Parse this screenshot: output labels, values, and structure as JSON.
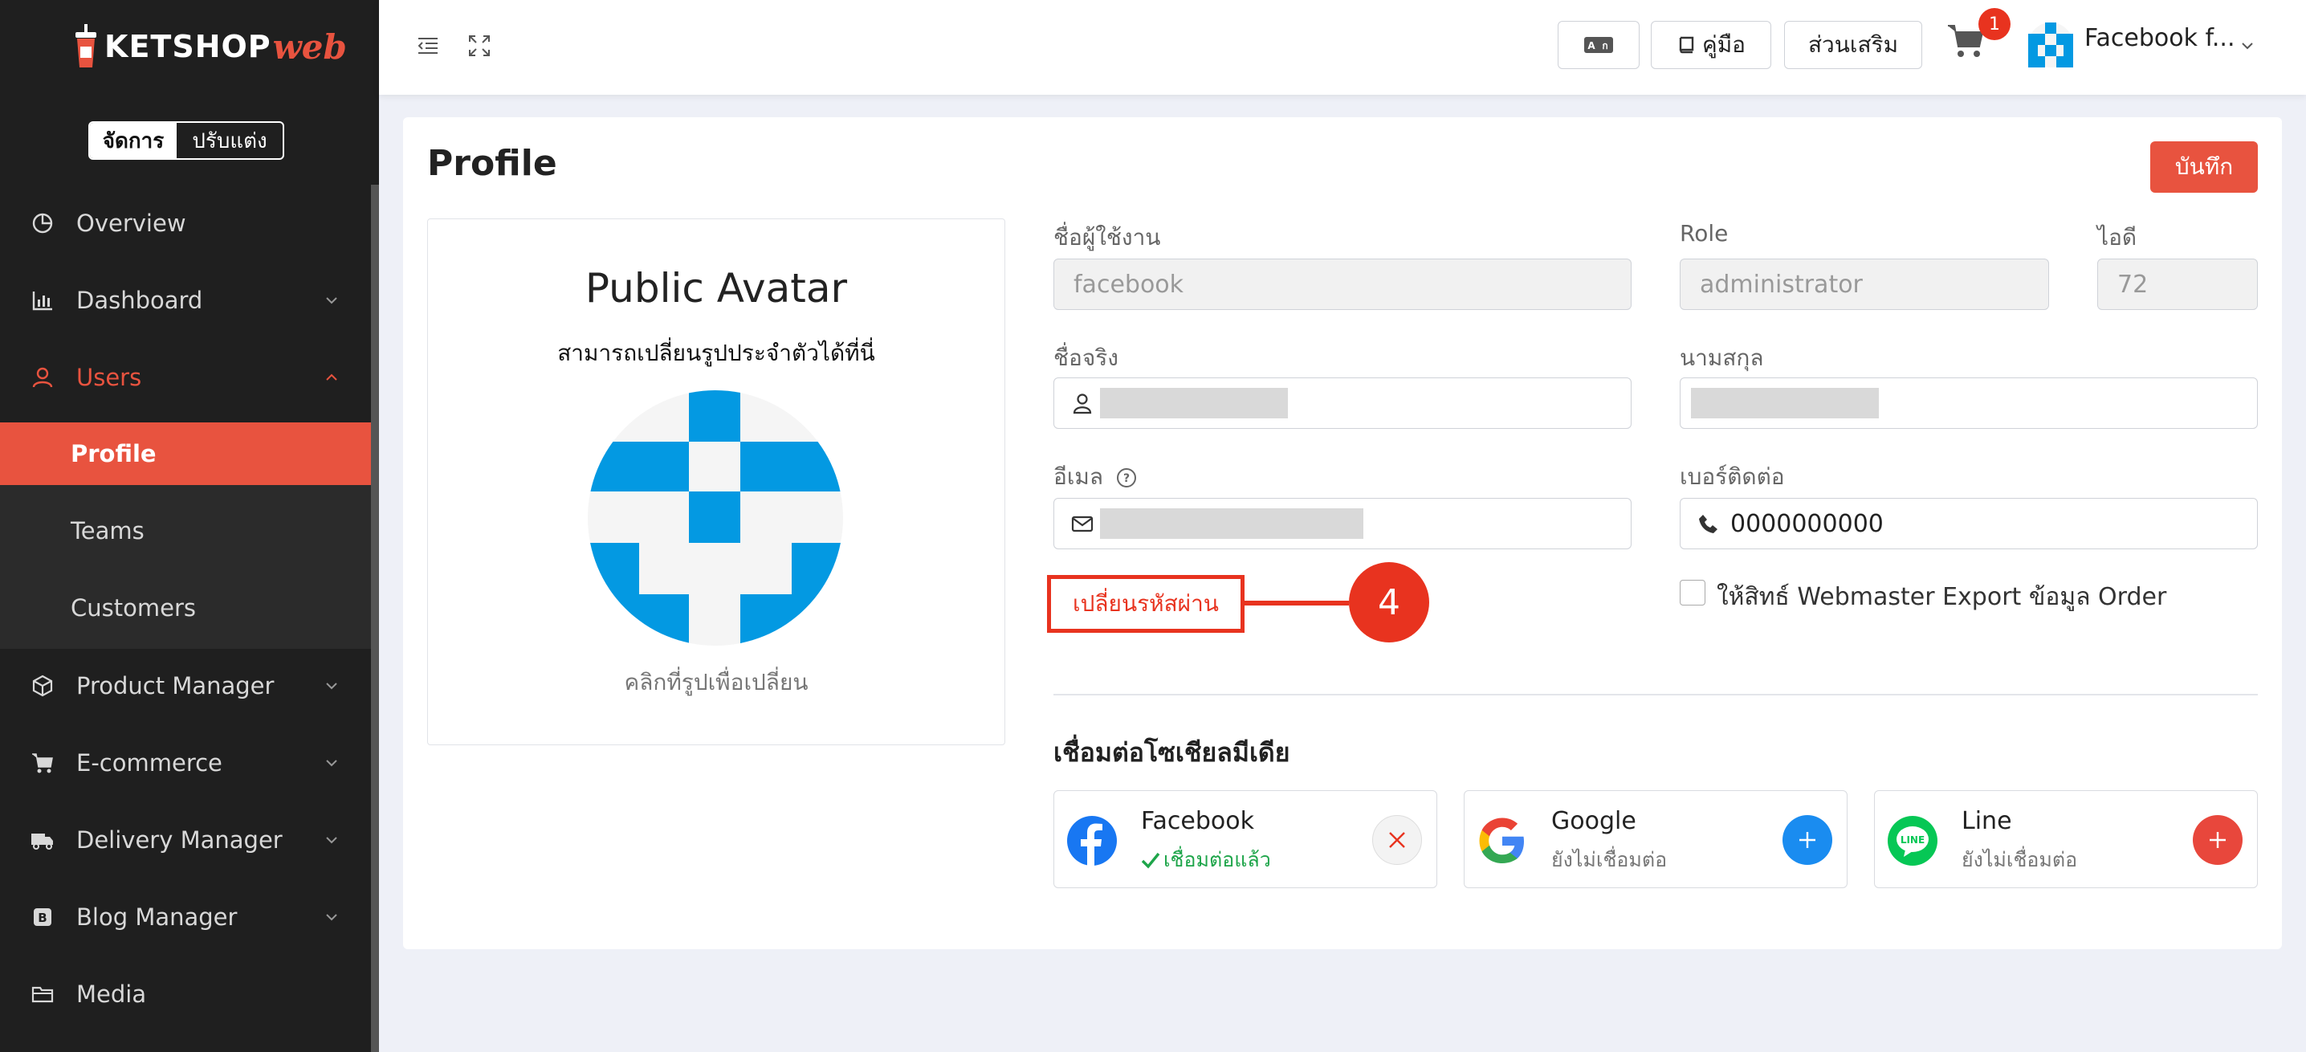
{
  "brand": {
    "name_a": "KETSHOP",
    "name_b": "web"
  },
  "mode_toggle": {
    "manage": "จัดการ",
    "customize": "ปรับแต่ง"
  },
  "sidebar": {
    "items": [
      {
        "label": "Overview"
      },
      {
        "label": "Dashboard"
      },
      {
        "label": "Users"
      },
      {
        "label": "Product Manager"
      },
      {
        "label": "E-commerce"
      },
      {
        "label": "Delivery Manager"
      },
      {
        "label": "Blog Manager"
      },
      {
        "label": "Media"
      }
    ],
    "users_sub": [
      {
        "label": "Profile"
      },
      {
        "label": "Teams"
      },
      {
        "label": "Customers"
      }
    ]
  },
  "topbar": {
    "manual_label": "คู่มือ",
    "addons_label": "ส่วนเสริม",
    "cart_count": "1",
    "user_name": "Facebook f..."
  },
  "page": {
    "title": "Profile",
    "save_label": "บันทึก"
  },
  "avatar": {
    "title": "Public Avatar",
    "subtitle": "สามารถเปลี่ยนรูปประจำตัวได้ที่นี่",
    "hint": "คลิกที่รูปเพื่อเปลี่ยน"
  },
  "form": {
    "username_label": "ชื่อผู้ใช้งาน",
    "username_value": "facebook",
    "role_label": "Role",
    "role_value": "administrator",
    "id_label": "ไอดี",
    "id_value": "72",
    "firstname_label": "ชื่อจริง",
    "lastname_label": "นามสกุล",
    "email_label": "อีเมล",
    "phone_label": "เบอร์ติดต่อ",
    "phone_value": "0000000000",
    "change_password": "เปลี่ยนรหัสผ่าน",
    "step_number": "4",
    "export_permission": "ให้สิทธ์ Webmaster Export ข้อมูล Order"
  },
  "social": {
    "title": "เชื่อมต่อโซเชียลมีเดีย",
    "accounts": [
      {
        "name": "Facebook",
        "status": "เชื่อมต่อแล้ว"
      },
      {
        "name": "Google",
        "status": "ยังไม่เชื่อมต่อ"
      },
      {
        "name": "Line",
        "status": "ยังไม่เชื่อมต่อ"
      }
    ]
  },
  "colors": {
    "accent": "#e8533f",
    "sidebar_bg": "#1f1f1f",
    "connected": "#1ea54a",
    "google_btn": "#1a8cf0"
  }
}
